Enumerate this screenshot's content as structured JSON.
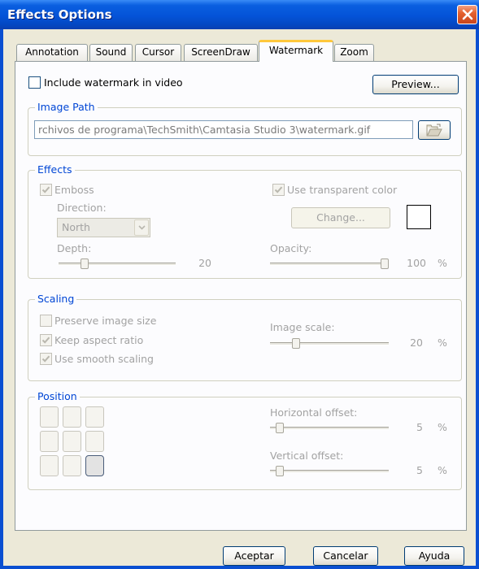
{
  "window": {
    "title": "Effects Options"
  },
  "tabs": [
    {
      "label": "Annotation",
      "active": false
    },
    {
      "label": "Sound",
      "active": false
    },
    {
      "label": "Cursor",
      "active": false
    },
    {
      "label": "ScreenDraw",
      "active": false
    },
    {
      "label": "Watermark",
      "active": true
    },
    {
      "label": "Zoom",
      "active": false
    }
  ],
  "watermark": {
    "include_label": "Include watermark in video",
    "include_checked": false,
    "preview_label": "Preview..."
  },
  "image_path": {
    "title": "Image Path",
    "value": "rchivos de programa\\TechSmith\\Camtasia Studio 3\\watermark.gif",
    "browse_icon": "folder-open-icon"
  },
  "effects": {
    "title": "Effects",
    "emboss_label": "Emboss",
    "emboss_checked": true,
    "direction_label": "Direction:",
    "direction_value": "North",
    "depth_label": "Depth:",
    "depth_value": "20",
    "depth_fraction": 0.2,
    "transparent_label": "Use transparent color",
    "transparent_checked": true,
    "change_label": "Change...",
    "transparent_color": "#ffffff",
    "opacity_label": "Opacity:",
    "opacity_value": "100",
    "opacity_unit": "%",
    "opacity_fraction": 1.0
  },
  "scaling": {
    "title": "Scaling",
    "preserve_label": "Preserve image size",
    "preserve_checked": false,
    "aspect_label": "Keep aspect ratio",
    "aspect_checked": true,
    "smooth_label": "Use smooth scaling",
    "smooth_checked": true,
    "image_scale_label": "Image scale:",
    "image_scale_value": "20",
    "image_scale_unit": "%",
    "image_scale_fraction": 0.2
  },
  "position": {
    "title": "Position",
    "selected_cell": "bottom-right",
    "horizontal_label": "Horizontal offset:",
    "horizontal_value": "5",
    "horizontal_unit": "%",
    "horizontal_fraction": 0.05,
    "vertical_label": "Vertical offset:",
    "vertical_value": "5",
    "vertical_unit": "%",
    "vertical_fraction": 0.05
  },
  "footer": {
    "ok_label": "Aceptar",
    "cancel_label": "Cancelar",
    "help_label": "Ayuda"
  },
  "colors": {
    "titlebar": "#0453d8",
    "accent_tab": "#ffc83c",
    "group_title": "#0046d5",
    "disabled_text": "#a2a2a2"
  }
}
